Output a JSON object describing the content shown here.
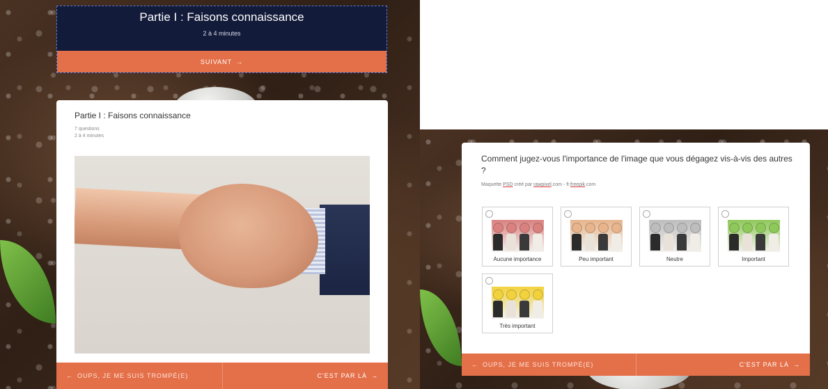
{
  "top_card": {
    "title": "Partie I : Faisons connaissance",
    "duration": "2 à 4 minutes",
    "next_label": "SUIVANT",
    "next_arrow": "→"
  },
  "left_card": {
    "title": "Partie I : Faisons connaissance",
    "questions": "7 questions",
    "duration": "2 à 4 minutes",
    "image_icon": "handshake-photo"
  },
  "nav": {
    "back_arrow": "←",
    "back_label": "OUPS, JE ME SUIS TROMPÉ(E)",
    "forward_label": "C'EST PAR LÀ",
    "forward_arrow": "→"
  },
  "question": {
    "text": "Comment jugez-vous l'importance de l'image que vous dégagez vis-à-vis des autres ?",
    "credit_prefix": "Maquette ",
    "credit_psd": "PSD",
    "credit_mid": " créé par ",
    "credit_rawpixel": "rawpixel",
    "credit_mid2": ".com - fr.",
    "credit_freepik": "freepik",
    "credit_suffix": ".com",
    "options": [
      {
        "label": "Aucune importance",
        "tint": "#d9817f"
      },
      {
        "label": "Peu important",
        "tint": "#e7b48c"
      },
      {
        "label": "Neutre",
        "tint": "#bdbdbd"
      },
      {
        "label": "Important",
        "tint": "#8fc85a"
      },
      {
        "label": "Très important",
        "tint": "#f2d23c"
      }
    ]
  },
  "colors": {
    "accent": "#e4704a",
    "top_card_bg": "#131b3a"
  }
}
